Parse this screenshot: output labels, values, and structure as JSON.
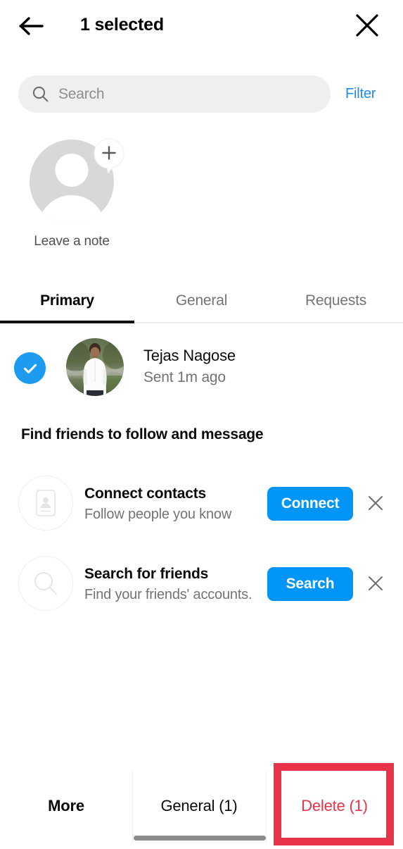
{
  "header": {
    "back_icon": "arrow-left-icon",
    "title": "1 selected",
    "close_icon": "close-icon"
  },
  "search": {
    "icon": "search-icon",
    "placeholder": "Search",
    "value": "",
    "filter_label": "Filter"
  },
  "note": {
    "avatar_icon": "default-avatar-icon",
    "plus_icon": "plus-icon",
    "label": "Leave a note"
  },
  "tabs": [
    {
      "label": "Primary",
      "active": true
    },
    {
      "label": "General",
      "active": false
    },
    {
      "label": "Requests",
      "active": false
    }
  ],
  "thread": {
    "selected": true,
    "check_icon": "check-circle-icon",
    "avatar": "user-photo-avatar",
    "name": "Tejas Nagose",
    "status": "Sent 1m ago"
  },
  "suggestions": {
    "heading": "Find friends to follow and message",
    "items": [
      {
        "icon": "contact-card-icon",
        "title": "Connect contacts",
        "subtitle": "Follow people you know",
        "cta_label": "Connect",
        "dismiss_icon": "close-icon"
      },
      {
        "icon": "magnifier-icon",
        "title": "Search for friends",
        "subtitle": "Find your friends' accounts.",
        "cta_label": "Search",
        "dismiss_icon": "close-icon"
      }
    ]
  },
  "bottom_bar": {
    "more_label": "More",
    "general_label": "General (1)",
    "delete_label": "Delete (1)"
  },
  "colors": {
    "accent_blue": "#0095f6",
    "link_blue": "#1a8cf0",
    "check_blue": "#1c9bf0",
    "danger_red": "#e8334a",
    "search_bg": "#efefef",
    "secondary_text": "#737373"
  }
}
